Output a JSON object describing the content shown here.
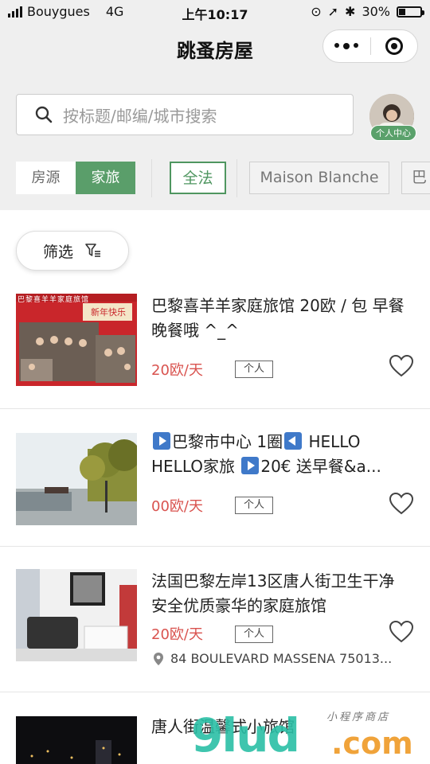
{
  "status_bar": {
    "carrier": "Bouygues",
    "network": "4G",
    "time": "上午10:17",
    "battery": "30%"
  },
  "nav": {
    "title": "跳蚤房屋"
  },
  "search": {
    "placeholder": "按标题/邮编/城市搜索",
    "avatar_badge": "个人中心"
  },
  "tabs": {
    "segment": [
      "房源",
      "家旅"
    ],
    "active_segment": "家旅",
    "chips": [
      "全法",
      "Maison Blanche",
      "巴"
    ],
    "active_chip": "全法"
  },
  "filter": {
    "label": "筛选"
  },
  "listings": [
    {
      "title": "巴黎喜羊羊家庭旅馆 20欧 / 包 早餐 晚餐哦 ^_^",
      "price": "20欧/天",
      "tag": "个人",
      "thumb_caption": "巴黎喜羊羊家庭旅馆",
      "thumb_banner": "新年快乐"
    },
    {
      "title_parts": [
        "巴黎市中心 1圈",
        "HELLO HELLO家旅",
        "20€ 送早餐&a..."
      ],
      "price": "00欧/天",
      "tag": "个人"
    },
    {
      "title": "法国巴黎左岸13区唐人街卫生干净 安全优质豪华的家庭旅馆",
      "price": "20欧/天",
      "tag": "个人",
      "address": "84 BOULEVARD MASSENA 75013..."
    },
    {
      "title": "唐人街温馨式小旅馆"
    }
  ],
  "watermark": {
    "main": "9lud",
    "suffix": ".com",
    "sub": "小程序商店"
  },
  "colors": {
    "accent_green": "#5a9e6a",
    "price_red": "#d9534f",
    "nav_bg": "#efefef"
  }
}
